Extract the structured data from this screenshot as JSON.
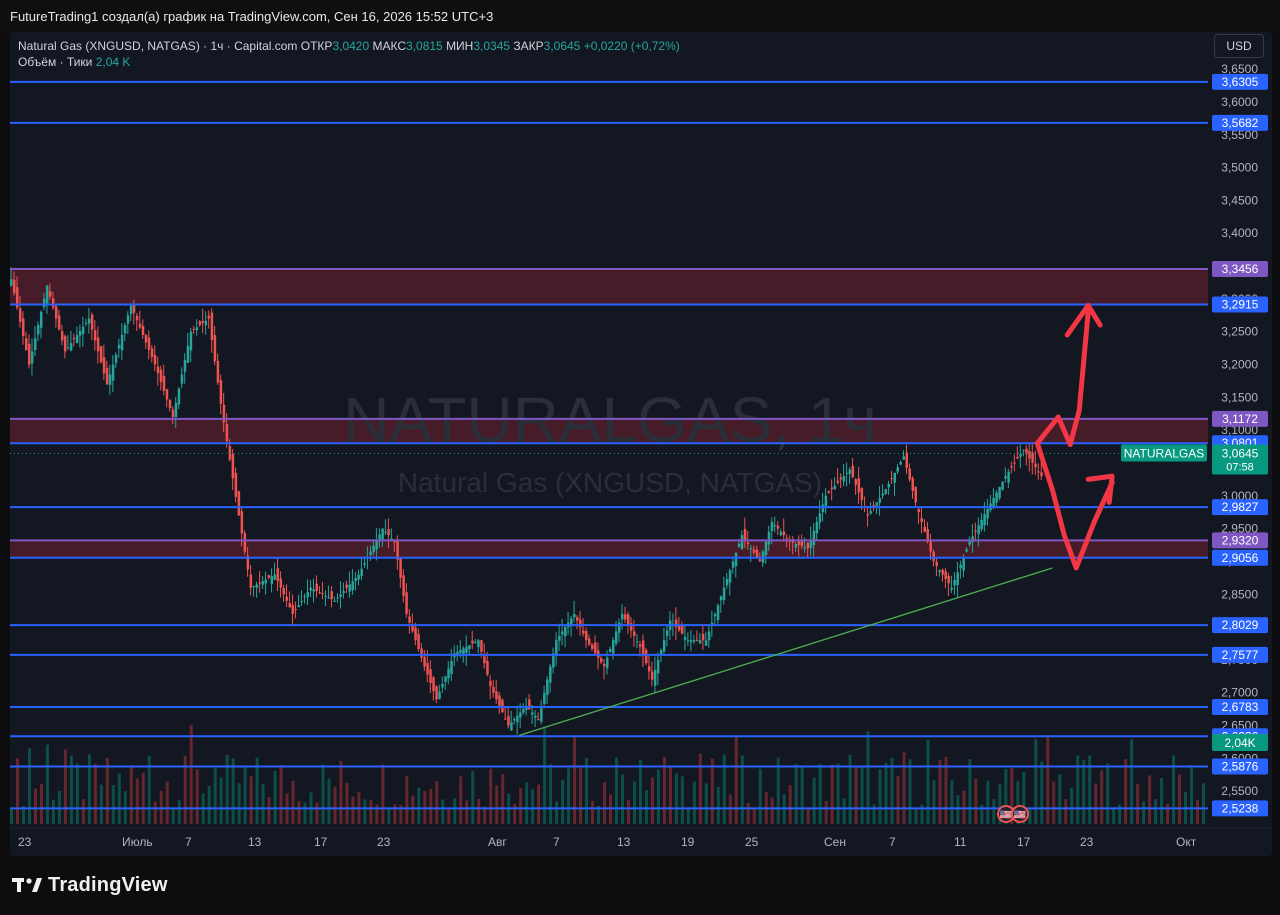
{
  "header": {
    "credit": "FutureTrading1 создал(а) график на TradingView.com, Сен 16, 2026 15:52 UTC+3"
  },
  "legend": {
    "symbol": "Natural Gas (XNGUSD, NATGAS) · 1ч · Capital.com",
    "open_label": "ОТКР",
    "open_value": "3,0420",
    "high_label": "МАКС",
    "high_value": "3,0815",
    "low_label": "МИН",
    "low_value": "3,0345",
    "close_label": "ЗАКР",
    "close_value": "3,0645",
    "change": "+0,0220 (+0,72%)",
    "volume_label": "Объём · Тики",
    "volume_value": "2,04 K"
  },
  "currency_button": "USD",
  "watermark": {
    "title": "NATURALGAS, 1ч",
    "subtitle": "Natural Gas (XNGUSD, NATGAS)"
  },
  "footer": {
    "brand": "TradingView"
  },
  "chart_data": {
    "type": "candlestick",
    "symbol": "NATURALGAS",
    "timeframe": "1ч",
    "ylim": [
      2.5,
      3.67
    ],
    "y_ticks": [
      "3,6500",
      "3,6000",
      "3,5500",
      "3,5000",
      "3,4500",
      "3,4000",
      "3,3500",
      "3,3000",
      "3,2500",
      "3,2000",
      "3,1500",
      "3,1000",
      "3,0500",
      "3,0000",
      "2,9500",
      "2,9000",
      "2,8500",
      "2,8000",
      "2,7500",
      "2,7000",
      "2,6500",
      "2,6000",
      "2,5500"
    ],
    "y_tick_values": [
      3.65,
      3.6,
      3.55,
      3.5,
      3.45,
      3.4,
      3.35,
      3.3,
      3.25,
      3.2,
      3.15,
      3.1,
      3.05,
      3.0,
      2.95,
      2.9,
      2.85,
      2.8,
      2.75,
      2.7,
      2.65,
      2.6,
      2.55
    ],
    "x_ticks": [
      "23",
      "Июль",
      "7",
      "13",
      "17",
      "23",
      "Авг",
      "7",
      "13",
      "19",
      "25",
      "Сен",
      "7",
      "11",
      "17",
      "23",
      "Окт"
    ],
    "horizontal_levels": [
      {
        "value": 3.6305,
        "label": "3,6305",
        "color": "#2962ff"
      },
      {
        "value": 3.5682,
        "label": "3,5682",
        "color": "#2962ff"
      },
      {
        "value": 3.3456,
        "label": "3,3456",
        "color": "#7e57c2"
      },
      {
        "value": 3.2915,
        "label": "3,2915",
        "color": "#2962ff"
      },
      {
        "value": 3.1172,
        "label": "3,1172",
        "color": "#7e57c2"
      },
      {
        "value": 3.0801,
        "label": "3,0801",
        "color": "#2962ff"
      },
      {
        "value": 2.9827,
        "label": "2,9827",
        "color": "#2962ff"
      },
      {
        "value": 2.932,
        "label": "2,9320",
        "color": "#7e57c2"
      },
      {
        "value": 2.9056,
        "label": "2,9056",
        "color": "#2962ff"
      },
      {
        "value": 2.8029,
        "label": "2,8029",
        "color": "#2962ff"
      },
      {
        "value": 2.7577,
        "label": "2,7577",
        "color": "#2962ff"
      },
      {
        "value": 2.6783,
        "label": "2,6783",
        "color": "#2962ff"
      },
      {
        "value": 2.6336,
        "label": "2,6336",
        "color": "#2962ff"
      },
      {
        "value": 2.5876,
        "label": "2,5876",
        "color": "#2962ff"
      },
      {
        "value": 2.5238,
        "label": "2,5238",
        "color": "#2962ff"
      }
    ],
    "zones": [
      {
        "from": 3.2915,
        "to": 3.3456,
        "color": "#5a1f2c"
      },
      {
        "from": 3.0801,
        "to": 3.1172,
        "color": "#5a1f2c"
      },
      {
        "from": 2.9056,
        "to": 2.932,
        "color": "#5a1f2c"
      }
    ],
    "current_price": {
      "value": 3.0645,
      "label": "3,0645",
      "countdown": "07:58",
      "name": "NATURALGAS",
      "color": "#089981"
    },
    "volume_label": {
      "label": "2,04K",
      "color": "#089981"
    },
    "path": [
      [
        0,
        3.33
      ],
      [
        3,
        3.2
      ],
      [
        6,
        3.32
      ],
      [
        9,
        3.22
      ],
      [
        13,
        3.27
      ],
      [
        16,
        3.17
      ],
      [
        20,
        3.29
      ],
      [
        24,
        3.2
      ],
      [
        27,
        3.12
      ],
      [
        30,
        3.25
      ],
      [
        33,
        3.27
      ],
      [
        35,
        3.14
      ],
      [
        38,
        2.97
      ],
      [
        40,
        2.86
      ],
      [
        44,
        2.88
      ],
      [
        47,
        2.82
      ],
      [
        50,
        2.86
      ],
      [
        54,
        2.84
      ],
      [
        58,
        2.88
      ],
      [
        62,
        2.95
      ],
      [
        64,
        2.93
      ],
      [
        66,
        2.82
      ],
      [
        69,
        2.74
      ],
      [
        71,
        2.69
      ],
      [
        74,
        2.76
      ],
      [
        78,
        2.78
      ],
      [
        80,
        2.71
      ],
      [
        83,
        2.65
      ],
      [
        86,
        2.68
      ],
      [
        88,
        2.66
      ],
      [
        91,
        2.78
      ],
      [
        94,
        2.82
      ],
      [
        96,
        2.78
      ],
      [
        99,
        2.74
      ],
      [
        102,
        2.82
      ],
      [
        105,
        2.77
      ],
      [
        107,
        2.72
      ],
      [
        110,
        2.81
      ],
      [
        113,
        2.78
      ],
      [
        116,
        2.78
      ],
      [
        119,
        2.86
      ],
      [
        122,
        2.94
      ],
      [
        125,
        2.9
      ],
      [
        127,
        2.96
      ],
      [
        130,
        2.93
      ],
      [
        133,
        2.92
      ],
      [
        136,
        3.0
      ],
      [
        140,
        3.04
      ],
      [
        143,
        2.97
      ],
      [
        146,
        3.01
      ],
      [
        149,
        3.06
      ],
      [
        151,
        2.99
      ],
      [
        154,
        2.9
      ],
      [
        157,
        2.86
      ],
      [
        160,
        2.93
      ],
      [
        163,
        2.98
      ],
      [
        166,
        3.03
      ],
      [
        169,
        3.07
      ],
      [
        172,
        3.03
      ]
    ],
    "path_x_domain": [
      0,
      200
    ],
    "volume_count": 200,
    "trendline": {
      "from": [
        85,
        2.635
      ],
      "to": [
        174,
        2.89
      ],
      "color": "#4caf50"
    },
    "annotation_color": "#f23645",
    "badges": [
      "🇺🇸",
      "🇺🇸"
    ]
  }
}
